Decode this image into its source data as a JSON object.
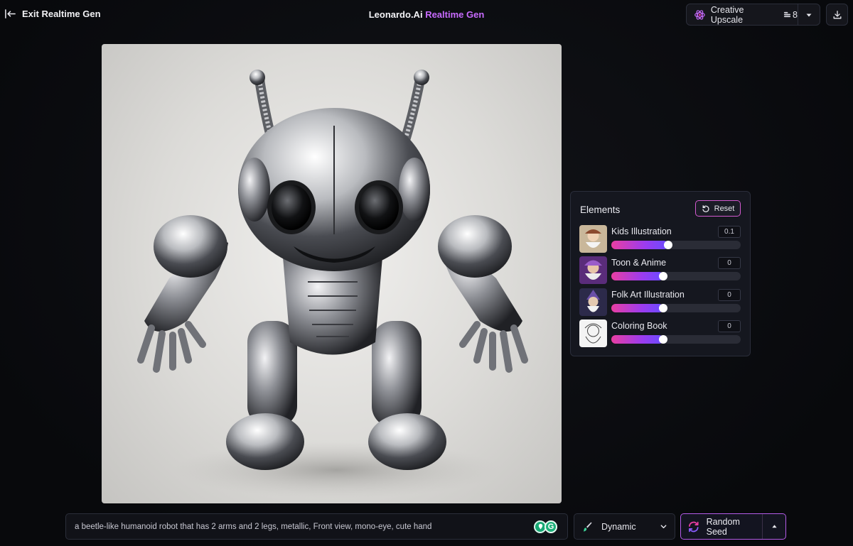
{
  "header": {
    "exit_label": "Exit Realtime Gen",
    "brand_main": "Leonardo.Ai",
    "brand_sub": "Realtime Gen",
    "upscale_label": "Creative Upscale",
    "upscale_count": "8"
  },
  "elements_panel": {
    "title": "Elements",
    "reset_label": "Reset",
    "items": [
      {
        "name": "Kids Illustration",
        "value": "0.1",
        "level": 0.44
      },
      {
        "name": "Toon & Anime",
        "value": "0",
        "level": 0.4
      },
      {
        "name": "Folk Art Illustration",
        "value": "0",
        "level": 0.4
      },
      {
        "name": "Coloring Book",
        "value": "0",
        "level": 0.4
      }
    ]
  },
  "bottom": {
    "prompt": "a beetle-like humanoid robot that has 2 arms and 2 legs, metallic, Front view, mono-eye, cute hand",
    "style_label": "Dynamic",
    "seed_label": "Random Seed"
  },
  "colors": {
    "accent_purple": "#c86bff",
    "accent_pink": "#e93ea2",
    "background": "#0b0c10"
  }
}
